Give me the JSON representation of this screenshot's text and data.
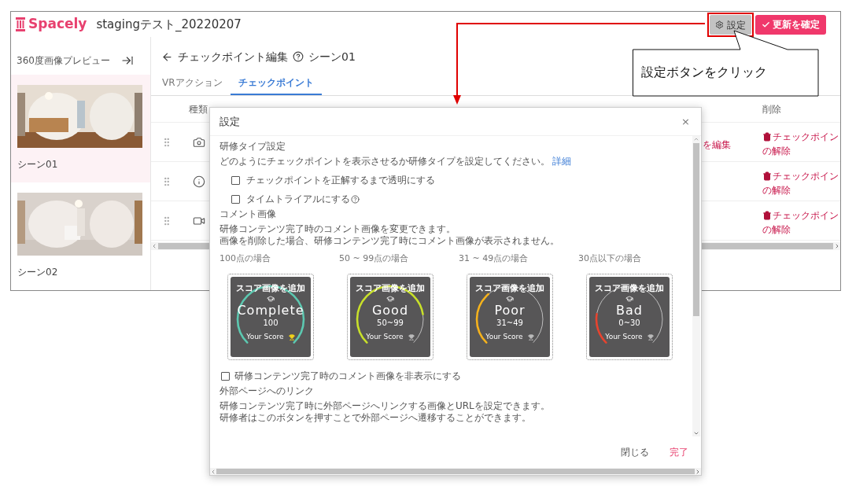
{
  "header": {
    "logo": "Spacely",
    "project_title": "stagingテスト_20220207",
    "settings_button": "設定",
    "confirm_button": "更新を確定"
  },
  "sidebar": {
    "title": "360度画像プレビュー",
    "scenes": [
      {
        "name": "シーン01",
        "selected": true,
        "kind": "living"
      },
      {
        "name": "シーン02",
        "selected": false,
        "kind": "bath"
      }
    ]
  },
  "editor": {
    "title": "チェックポイント編集",
    "scene": "シーン01",
    "tabs": [
      {
        "label": "VRアクション",
        "selected": false
      },
      {
        "label": "チェックポイント",
        "selected": true
      }
    ],
    "table": {
      "columns": [
        "種類",
        "削除"
      ],
      "rows": [
        {
          "kind": "camera",
          "action": "を編集",
          "delete_lines": [
            "チェックポイン",
            "の解除"
          ]
        },
        {
          "kind": "info",
          "delete_lines": [
            "チェックポイン",
            "の解除"
          ]
        },
        {
          "kind": "video",
          "delete_lines": [
            "チェックポイン",
            "の解除"
          ]
        }
      ]
    }
  },
  "dialog": {
    "title": "設定",
    "close": "×",
    "training_type": {
      "heading": "研修タイプ設定",
      "description": "どのようにチェックポイントを表示させるか研修タイプを設定してください。",
      "link": "詳細",
      "options": [
        {
          "label": "チェックポイントを正解するまで透明にする",
          "checked": false,
          "help": false
        },
        {
          "label": "タイムトライアルにする",
          "checked": false,
          "help": true
        }
      ]
    },
    "comment_image": {
      "heading": "コメント画像",
      "description": [
        "研修コンテンツ完了時のコメント画像を変更できます。",
        "画像を削除した場合、研修コンテンツ完了時にコメント画像が表示されません。"
      ],
      "cards": [
        {
          "label": "100点の場合",
          "kind": "complete",
          "overlay": "スコア画像を追加",
          "word": "Complete",
          "range": "100",
          "footer": "Your Score",
          "color": "#5cc8b0",
          "trophy_lit": true
        },
        {
          "label": "50 ~ 99点の場合",
          "kind": "good",
          "overlay": "スコア画像を追加",
          "word": "Good",
          "range": "50~99",
          "footer": "Your Score",
          "color": "#c8e02a",
          "trophy_lit": false
        },
        {
          "label": "31 ~ 49点の場合",
          "kind": "poor",
          "overlay": "スコア画像を追加",
          "word": "Poor",
          "range": "31~49",
          "footer": "Your Score",
          "color": "#f5b21c",
          "trophy_lit": false
        },
        {
          "label": "30点以下の場合",
          "kind": "bad",
          "overlay": "スコア画像を追加",
          "word": "Bad",
          "range": "0~30",
          "footer": "Your Score",
          "color": "#e8432e",
          "trophy_lit": false
        }
      ],
      "hide_option": {
        "label": "研修コンテンツ完了時のコメント画像を非表示にする",
        "checked": false
      }
    },
    "external_link": {
      "heading": "外部ページへのリンク",
      "description": [
        "研修コンテンツ完了時に外部ページへリンクする画像とURLを設定できます。",
        "研修者はこのボタンを押すことで外部ページへ遷移することができます。"
      ]
    },
    "footer": {
      "close": "閉じる",
      "done": "完了"
    }
  },
  "annotation": {
    "callout": "設定ボタンをクリック"
  }
}
